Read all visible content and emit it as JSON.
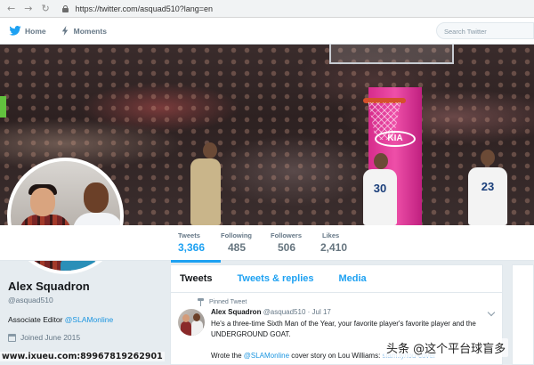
{
  "browser": {
    "url": "https://twitter.com/asquad510?lang=en"
  },
  "topnav": {
    "home_label": "Home",
    "moments_label": "Moments",
    "search_placeholder": "Search Twitter"
  },
  "stats": [
    {
      "label": "Tweets",
      "value": "3,366"
    },
    {
      "label": "Following",
      "value": "485"
    },
    {
      "label": "Followers",
      "value": "506"
    },
    {
      "label": "Likes",
      "value": "2,410"
    }
  ],
  "profile": {
    "name": "Alex Squadron",
    "handle": "@asquad510",
    "bio_prefix": "Associate Editor ",
    "bio_link": "@SLAMonline",
    "joined": "Joined June 2015"
  },
  "timeline": {
    "tabs": [
      "Tweets",
      "Tweets & replies",
      "Media"
    ],
    "pinned_label": "Pinned Tweet",
    "tweet": {
      "name": "Alex Squadron",
      "handle": "@asquad510",
      "date": "· Jul 17",
      "body": "He's a three-time Sixth Man of the Year, your favorite player's favorite player and the UNDERGROUND GOAT.",
      "body2_prefix": "Wrote the ",
      "body2_link": "@SLAMonline",
      "body2_mid": " cover story on Lou Williams: ",
      "body2_url": "slam.ly/lou-cover"
    }
  },
  "banner": {
    "kia_text": "KIA",
    "jersey_numbers": [
      "30",
      "23"
    ]
  },
  "watermarks": {
    "left": "www.ixueu.com:89967819262901",
    "right": "头条 @这个平台球盲多"
  },
  "colors": {
    "twitter_blue": "#1da1f2",
    "link_blue": "#1b95e0",
    "stanchion_pink": "#e23d9a"
  }
}
